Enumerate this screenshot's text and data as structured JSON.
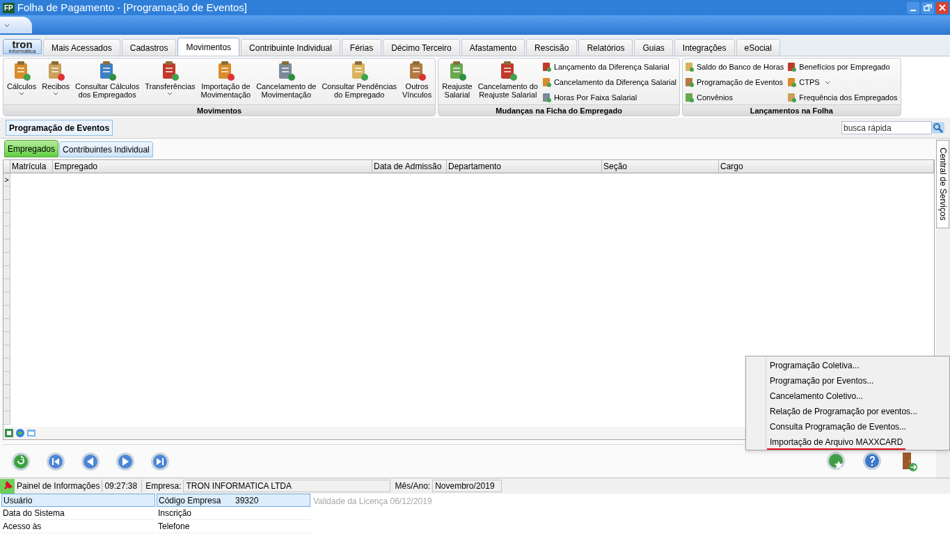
{
  "title_bar": {
    "app_badge": "FP",
    "title": "Folha de Pagamento - [Programação de Eventos]"
  },
  "logo": {
    "name": "tron",
    "sub": "informática"
  },
  "ribbon_tabs": [
    {
      "label": "Mais Acessados",
      "selected": false
    },
    {
      "label": "Cadastros",
      "selected": false
    },
    {
      "label": "Movimentos",
      "selected": true
    },
    {
      "label": "Contribuinte Individual",
      "selected": false
    },
    {
      "label": "Férias",
      "selected": false
    },
    {
      "label": "Décimo Terceiro",
      "selected": false
    },
    {
      "label": "Afastamento",
      "selected": false
    },
    {
      "label": "Rescisão",
      "selected": false
    },
    {
      "label": "Relatórios",
      "selected": false
    },
    {
      "label": "Guias",
      "selected": false
    },
    {
      "label": "Integrações",
      "selected": false
    },
    {
      "label": "eSocial",
      "selected": false
    }
  ],
  "ribbon_groups": [
    {
      "label": "Movimentos",
      "large": [
        {
          "lines": [
            "Cálculos"
          ],
          "dropdown": true
        },
        {
          "lines": [
            "Recibos"
          ],
          "dropdown": true
        },
        {
          "lines": [
            "Consultar Cálculos",
            "dos Empregados"
          ],
          "dropdown": false
        },
        {
          "lines": [
            "Transferências"
          ],
          "dropdown": true
        },
        {
          "lines": [
            "Importação de",
            "Movimentação"
          ],
          "dropdown": false
        },
        {
          "lines": [
            "Cancelamento de",
            "Movimentação"
          ],
          "dropdown": false
        },
        {
          "lines": [
            "Consultar Pendências",
            "do Empregado"
          ],
          "dropdown": false
        },
        {
          "lines": [
            "Outros",
            "Vínculos"
          ],
          "dropdown": false
        }
      ]
    },
    {
      "label": "Mudanças na Ficha do Empregado",
      "large": [
        {
          "lines": [
            "Reajuste",
            "Salarial"
          ],
          "dropdown": false
        },
        {
          "lines": [
            "Cancelamento do",
            "Reajuste Salarial"
          ],
          "dropdown": false
        }
      ],
      "small_columns": [
        [
          {
            "label": "Lançamento da Diferença Salarial",
            "dropdown": false
          },
          {
            "label": "Cancelamento da Diferença Salarial",
            "dropdown": false
          },
          {
            "label": "Horas Por Faixa Salarial",
            "dropdown": false
          }
        ]
      ]
    },
    {
      "label": "Lançamentos na Folha",
      "small_columns": [
        [
          {
            "label": "Saldo do Banco de Horas",
            "dropdown": false
          },
          {
            "label": "Programação de Eventos",
            "dropdown": false
          },
          {
            "label": "Convênios",
            "dropdown": false
          }
        ],
        [
          {
            "label": "Benefícios por Empregado",
            "dropdown": false
          },
          {
            "label": "CTPS",
            "dropdown": true
          },
          {
            "label": "Frequência dos Empregados",
            "dropdown": false
          }
        ]
      ]
    }
  ],
  "page_tab": "Programação de Eventos",
  "search": {
    "placeholder": "busca rápida"
  },
  "sub_tabs": [
    {
      "label": "Empregados",
      "selected": true
    },
    {
      "label": "Contribuintes Individual",
      "selected": false
    }
  ],
  "table": {
    "columns": [
      "Matrícula",
      "Empregado",
      "Data de Admissão",
      "Departamento",
      "Seção",
      "Cargo"
    ],
    "current_row_marker": ">"
  },
  "side_tab": "Central de Serviços",
  "context_menu": [
    {
      "label": "Programação Coletiva...",
      "highlighted": false
    },
    {
      "label": "Programação por Eventos...",
      "highlighted": false
    },
    {
      "label": "Cancelamento Coletivo...",
      "highlighted": false
    },
    {
      "label": "Relação de Programação por eventos...",
      "highlighted": false
    },
    {
      "label": "Consulta Programação de Eventos...",
      "highlighted": false
    },
    {
      "label": "Importação de Arquivo MAXXCARD",
      "highlighted": true
    }
  ],
  "status_bar": {
    "panel": "Painel de Informações",
    "time": "09:27:38",
    "company_label": "Empresa:",
    "company": "TRON INFORMATICA LTDA",
    "period_label": "Mês/Ano:",
    "period": "Novembro/2019"
  },
  "info": [
    {
      "label": "Usuário",
      "selected": true
    },
    {
      "label": "Data do Sistema",
      "selected": false
    },
    {
      "label": "Acesso às",
      "selected": false
    },
    {
      "label": "Código Empresa",
      "value": "39320",
      "selected": true
    },
    {
      "label": "Inscrição",
      "selected": false
    },
    {
      "label": "Telefone",
      "selected": false
    }
  ],
  "license": "Validade da Licença 06/12/2019"
}
